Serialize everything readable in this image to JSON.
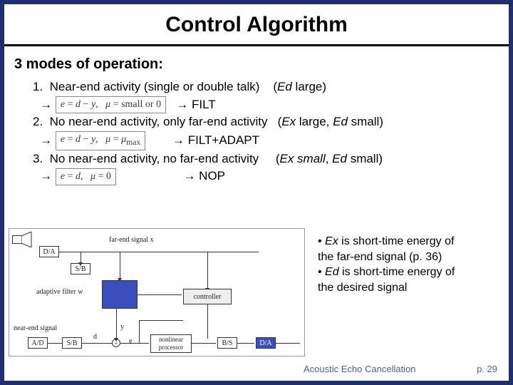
{
  "title": "Control Algorithm",
  "subheading": "3 modes of operation:",
  "modes": [
    {
      "num": "1.",
      "text": "Near-end activity (single or double talk)",
      "cond": "(Ed large)",
      "arrow1": "→",
      "formula": "e = d − y,   μ = small or 0",
      "arrow2": "→",
      "action": "FILT"
    },
    {
      "num": "2.",
      "text": "No near-end activity, only far-end activity",
      "cond": "(Ex large, Ed small)",
      "arrow1": "→",
      "formula": "e = d − y,   μ = μmax",
      "arrow2": "→",
      "action": "FILT+ADAPT"
    },
    {
      "num": "3.",
      "text": "No near-end activity, no far-end activity",
      "cond": "(Ex small, Ed small)",
      "arrow1": "→",
      "formula": "e = d,   μ = 0",
      "arrow2": "→",
      "action": "NOP"
    }
  ],
  "diagram": {
    "da1": "D/A",
    "sb1": "S/B",
    "far_end": "far-end signal x",
    "adaptive_filter": "adaptive filter w",
    "controller": "controller",
    "near_end": "near-end signal",
    "ad": "A/D",
    "sb2": "S/B",
    "d": "d",
    "y": "y",
    "e": "e",
    "nlp": "nonlinear processor",
    "bs": "B/S",
    "da2": "D/A"
  },
  "bullets": {
    "b1a": "• Ex is short-time energy of",
    "b1b": " the far-end signal (p. 36)",
    "b2a": "• Ed is short-time energy of",
    "b2b": " the desired signal"
  },
  "footer": {
    "mid": "Acoustic Echo Cancellation",
    "right": "p. 29"
  }
}
